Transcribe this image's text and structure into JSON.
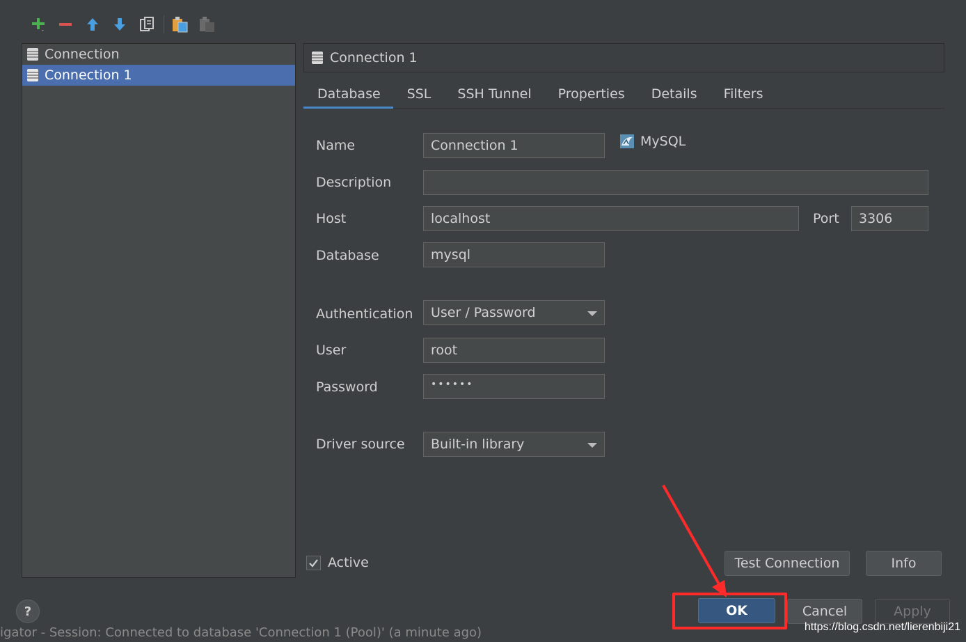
{
  "toolbar": {
    "icons": [
      "add-icon",
      "remove-icon",
      "move-up-icon",
      "move-down-icon",
      "copy-icon",
      "paste-icon",
      "delete-icon"
    ]
  },
  "connections": {
    "items": [
      {
        "label": "Connection",
        "selected": false
      },
      {
        "label": "Connection 1",
        "selected": true
      }
    ]
  },
  "header": {
    "title": "Connection 1"
  },
  "tabs": [
    {
      "label": "Database",
      "active": true
    },
    {
      "label": "SSL",
      "active": false
    },
    {
      "label": "SSH Tunnel",
      "active": false
    },
    {
      "label": "Properties",
      "active": false
    },
    {
      "label": "Details",
      "active": false
    },
    {
      "label": "Filters",
      "active": false
    }
  ],
  "form": {
    "name_label": "Name",
    "name_value": "Connection 1",
    "db_type": "MySQL",
    "description_label": "Description",
    "description_value": "",
    "host_label": "Host",
    "host_value": "localhost",
    "port_label": "Port",
    "port_value": "3306",
    "database_label": "Database",
    "database_value": "mysql",
    "auth_label": "Authentication",
    "auth_value": "User / Password",
    "user_label": "User",
    "user_value": "root",
    "password_label": "Password",
    "password_value": "••••••",
    "driver_label": "Driver source",
    "driver_value": "Built-in library"
  },
  "active": {
    "label": "Active",
    "checked": true
  },
  "buttons": {
    "test_connection": "Test Connection",
    "info": "Info",
    "ok": "OK",
    "cancel": "Cancel",
    "apply": "Apply",
    "help": "?"
  },
  "status_text": "igator - Session: Connected to database 'Connection 1 (Pool)' (a minute ago)",
  "watermark": "https://blog.csdn.net/lierenbiji21",
  "colors": {
    "background": "#3c3f41",
    "selection": "#4b6eaf",
    "primary_button": "#365880",
    "annotation": "#ff2a2a"
  }
}
